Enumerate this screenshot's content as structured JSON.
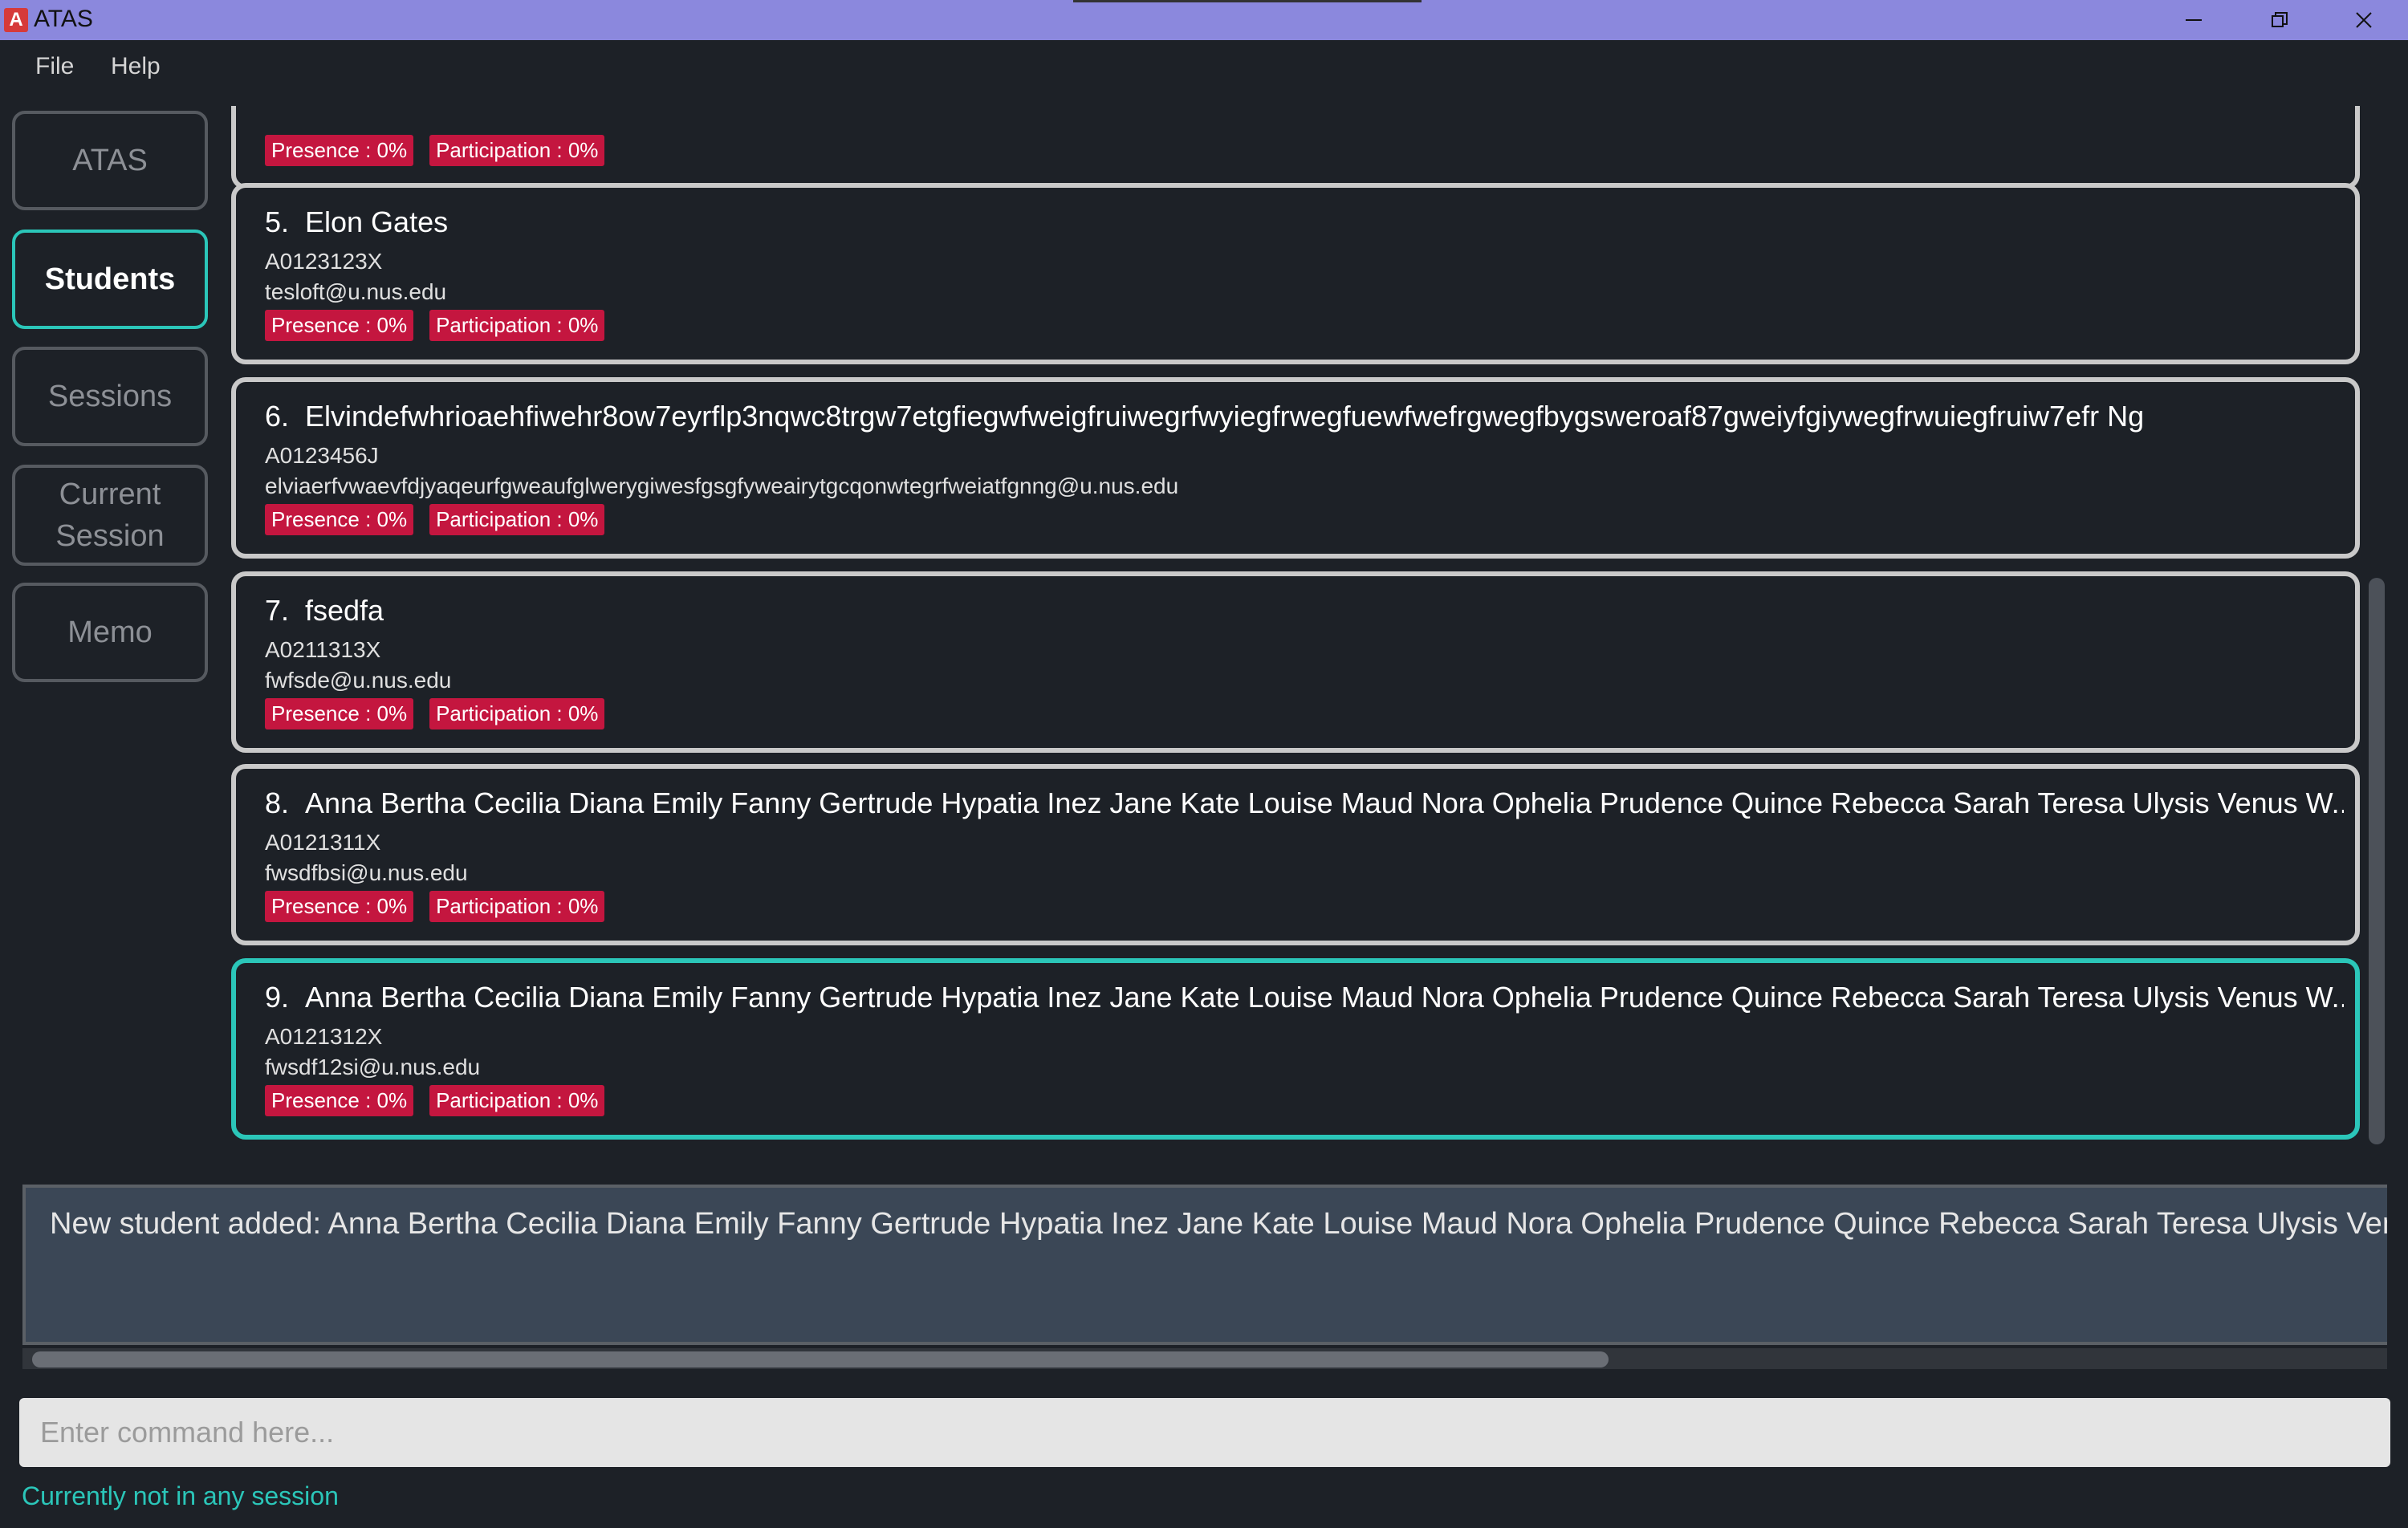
{
  "window": {
    "title": "ATAS",
    "app_icon_letter": "A",
    "controls": {
      "minimize_icon": "minimize-icon",
      "restore_icon": "restore-icon",
      "close_icon": "close-icon"
    }
  },
  "menu": {
    "file": "File",
    "help": "Help"
  },
  "sidebar": {
    "items": [
      {
        "label": "ATAS",
        "active": false
      },
      {
        "label": "Students",
        "active": true
      },
      {
        "label": "Sessions",
        "active": false
      },
      {
        "label": "Current Session",
        "active": false
      },
      {
        "label": "Memo",
        "active": false
      }
    ]
  },
  "students": [
    {
      "index": "",
      "name": "",
      "id": "",
      "email": "",
      "presence": "Presence : 0%",
      "participation": "Participation : 0%"
    },
    {
      "index": "5.",
      "name": "Elon Gates",
      "id": "A0123123X",
      "email": "tesloft@u.nus.edu",
      "presence": "Presence : 0%",
      "participation": "Participation : 0%"
    },
    {
      "index": "6.",
      "name": "Elvindefwhrioaehfiwehr8ow7eyrflp3nqwc8trgw7etgfiegwfweigfruiwegrfwyiegfrwegfuewfwefrgwegfbygsweroaf87gweiyfgiywegfrwuiegfruiw7efr Ng",
      "id": "A0123456J",
      "email": "elviaerfvwaevfdjyaqeurfgweaufglwerygiwesfgsgfyweairytgcqonwtegrfweiatfgnng@u.nus.edu",
      "presence": "Presence : 0%",
      "participation": "Participation : 0%"
    },
    {
      "index": "7.",
      "name": "fsedfa",
      "id": "A0211313X",
      "email": "fwfsde@u.nus.edu",
      "presence": "Presence : 0%",
      "participation": "Participation : 0%"
    },
    {
      "index": "8.",
      "name": "Anna Bertha Cecilia Diana Emily Fanny Gertrude Hypatia Inez Jane Kate Louise Maud Nora Ophelia Prudence Quince Rebecca Sarah Teresa Ulysis Venus W...",
      "id": "A0121311X",
      "email": "fwsdfbsi@u.nus.edu",
      "presence": "Presence : 0%",
      "participation": "Participation : 0%"
    },
    {
      "index": "9.",
      "name": "Anna Bertha Cecilia Diana Emily Fanny Gertrude Hypatia Inez Jane Kate Louise Maud Nora Ophelia Prudence Quince Rebecca Sarah Teresa Ulysis Venus W...",
      "id": "A0121312X",
      "email": "fwsdf12si@u.nus.edu",
      "presence": "Presence : 0%",
      "participation": "Participation : 0%"
    }
  ],
  "result_display": {
    "text": "New student added: Anna Bertha Cecilia Diana Emily Fanny Gertrude Hypatia Inez Jane Kate Louise Maud Nora Ophelia Prudence Quince Rebecca Sarah Teresa Ulysis Venus Winif"
  },
  "command": {
    "placeholder": "Enter command here...",
    "value": ""
  },
  "status": {
    "text": "Currently not in any session"
  },
  "colors": {
    "accent": "#2bc6b9",
    "tag": "#c4163f",
    "titlebar": "#8b88dd",
    "background": "#1d2127"
  }
}
